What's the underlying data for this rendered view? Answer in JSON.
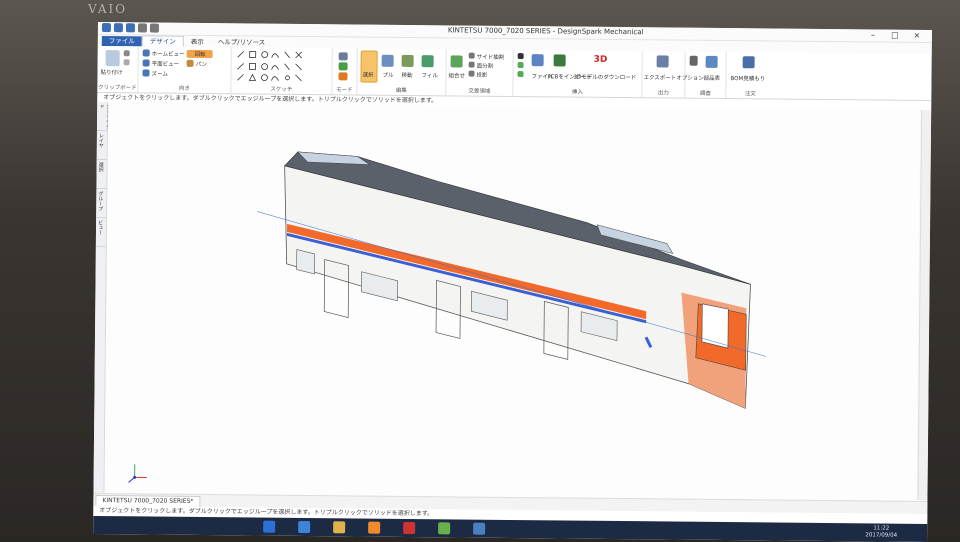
{
  "window": {
    "title": "KINTETSU 7000_7020 SERIES - DesignSpark Mechanical",
    "controls": [
      "–",
      "□",
      "×"
    ]
  },
  "tabs": [
    {
      "label": "ファイル"
    },
    {
      "label": "デザイン"
    },
    {
      "label": "表示"
    },
    {
      "label": "ヘルプ/リソース"
    }
  ],
  "ribbon": {
    "groups": {
      "clipboard": {
        "label": "クリップボード",
        "items": [
          "貼り付け"
        ]
      },
      "orient": {
        "label": "向き",
        "items": [
          "ホームビュー",
          "平面ビュー",
          "ズーム",
          "回転",
          "パン"
        ]
      },
      "sketch": {
        "label": "スケッチ"
      },
      "mode": {
        "label": "モード"
      },
      "edit": {
        "label": "編集",
        "items": [
          "選択",
          "プル",
          "移動",
          "フィル"
        ]
      },
      "intersect": {
        "label": "交差領域",
        "items": [
          "組合せ",
          "サイド抽割",
          "面分割",
          "投影"
        ]
      },
      "insert": {
        "label": "挿入",
        "items": [
          "ファイル",
          "PCBをインポート",
          "3Dモデルのダウンロード"
        ]
      },
      "output": {
        "label": "出力",
        "items": [
          "エクスポートオプション"
        ]
      },
      "investigate": {
        "label": "調査",
        "items": [
          "部品表"
        ]
      },
      "order": {
        "label": "注文",
        "items": [
          "BOM見積もり"
        ]
      }
    }
  },
  "hint": "オブジェクトをクリックします。ダブルクリックでエッジループを選択します。トリプルクリックでソリッドを選択します。",
  "sidepanel_tabs": [
    "ストラクチャ",
    "レイヤ",
    "選択",
    "グループ",
    "ビュー"
  ],
  "document_tab": "KINTETSU 7000_7020 SERIES*",
  "status_message": "オブジェクトをクリックします。ダブルクリックでエッジループを選択します。トリプルクリックでソリッドを選択します。",
  "taskbar": {
    "time": "11:22",
    "date": "2017/09/04",
    "ime": "A"
  },
  "brand": "VAIO",
  "colors": {
    "orange": "#f2692a",
    "blue": "#3a5fd6",
    "roof": "#5a6068",
    "accent": "#2f62b0"
  }
}
